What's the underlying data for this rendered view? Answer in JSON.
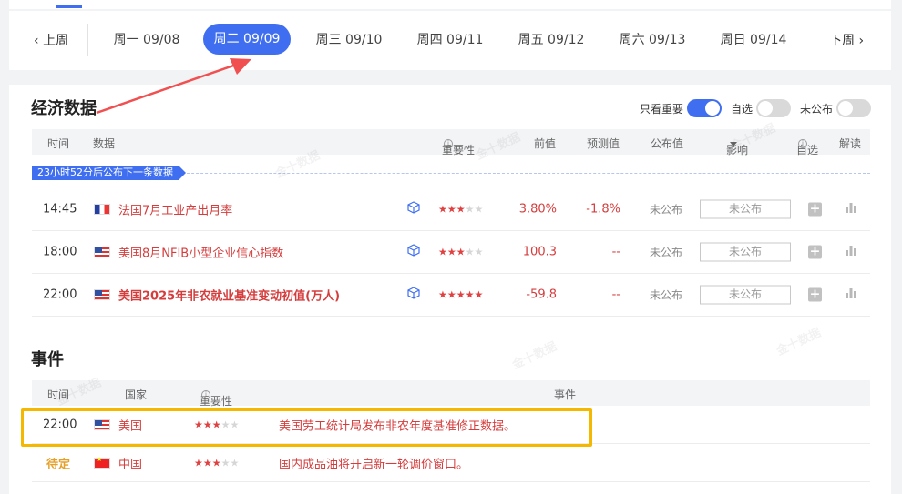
{
  "nav": {
    "prev_week": "上周",
    "next_week": "下周",
    "days": [
      {
        "label": "周一 09/08",
        "active": false
      },
      {
        "label": "周二 09/09",
        "active": true
      },
      {
        "label": "周三 09/10",
        "active": false
      },
      {
        "label": "周四 09/11",
        "active": false
      },
      {
        "label": "周五 09/12",
        "active": false
      },
      {
        "label": "周六 09/13",
        "active": false
      },
      {
        "label": "周日 09/14",
        "active": false
      }
    ]
  },
  "econ": {
    "title": "经济数据",
    "toggles": [
      {
        "label": "只看重要",
        "on": true
      },
      {
        "label": "自选",
        "on": false
      },
      {
        "label": "未公布",
        "on": false
      }
    ],
    "headers": {
      "time": "时间",
      "data": "数据",
      "importance": "重要性",
      "previous": "前值",
      "forecast": "预测值",
      "published": "公布值",
      "impact": "影响",
      "watch": "自选",
      "interpret": "解读"
    },
    "countdown": "23小时52分后公布下一条数据",
    "rows": [
      {
        "time": "14:45",
        "flag": "fr",
        "name": "法国7月工业产出月率",
        "stars": 3,
        "previous": "3.80%",
        "forecast": "-1.8%",
        "published": "未公布",
        "impact": "未公布",
        "bold": false
      },
      {
        "time": "18:00",
        "flag": "us",
        "name": "美国8月NFIB小型企业信心指数",
        "stars": 3,
        "previous": "100.3",
        "forecast": "--",
        "published": "未公布",
        "impact": "未公布",
        "bold": false
      },
      {
        "time": "22:00",
        "flag": "us",
        "name": "美国2025年非农就业基准变动初值(万人)",
        "stars": 5,
        "previous": "-59.8",
        "forecast": "--",
        "published": "未公布",
        "impact": "未公布",
        "bold": true
      }
    ]
  },
  "events": {
    "title": "事件",
    "headers": {
      "time": "时间",
      "country": "国家",
      "importance": "重要性",
      "event": "事件"
    },
    "rows": [
      {
        "time": "22:00",
        "flag": "us",
        "country": "美国",
        "stars": 3,
        "text": "美国劳工统计局发布非农年度基准修正数据。",
        "pending": false
      },
      {
        "time": "待定",
        "flag": "cn",
        "country": "中国",
        "stars": 3,
        "text": "国内成品油将开启新一轮调价窗口。",
        "pending": true
      }
    ]
  },
  "watermark": "金十数据",
  "colors": {
    "accent": "#3f6ff0",
    "red": "#d53d3d",
    "highlight": "#f5b800",
    "arrow": "#f05050"
  },
  "icons": {
    "cube": "cube-icon",
    "plus": "plus-icon",
    "bar": "bar-chart-icon"
  }
}
